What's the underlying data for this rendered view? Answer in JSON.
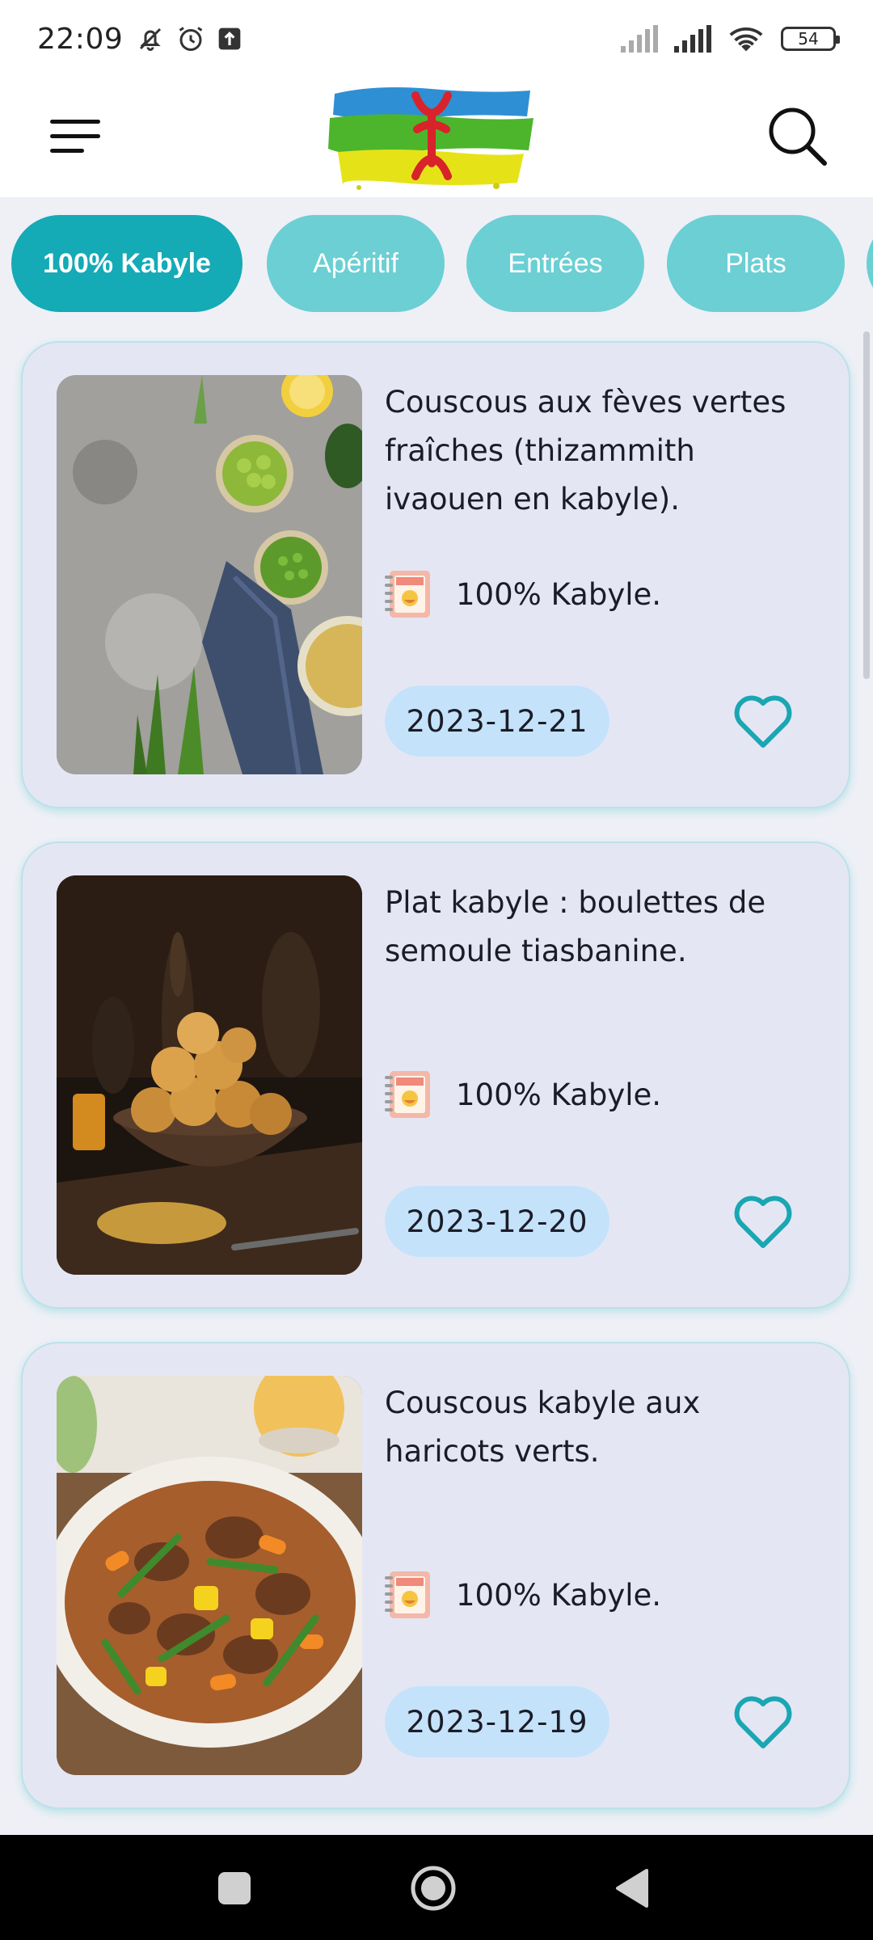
{
  "status_bar": {
    "time": "22:09",
    "battery": "54"
  },
  "chips": [
    {
      "label": "100% Kabyle",
      "active": true
    },
    {
      "label": "Apéritif",
      "active": false
    },
    {
      "label": "Entrées",
      "active": false
    },
    {
      "label": "Plats",
      "active": false
    }
  ],
  "recipes": [
    {
      "title": "Couscous aux fèves vertes fraîches (thizammith ivaouen en kabyle).",
      "category": "100% Kabyle.",
      "date": "2023-12-21"
    },
    {
      "title": "Plat kabyle : boulettes de semoule tiasbanine.",
      "category": "100% Kabyle.",
      "date": "2023-12-20"
    },
    {
      "title": "Couscous kabyle aux haricots verts.",
      "category": "100% Kabyle.",
      "date": "2023-12-19"
    }
  ],
  "colors": {
    "accent": "#14aab6",
    "chip": "#6bcfd3",
    "card": "#e4e7f3",
    "date_pill": "#c4e3fb",
    "heart": "#1aa6b3"
  }
}
